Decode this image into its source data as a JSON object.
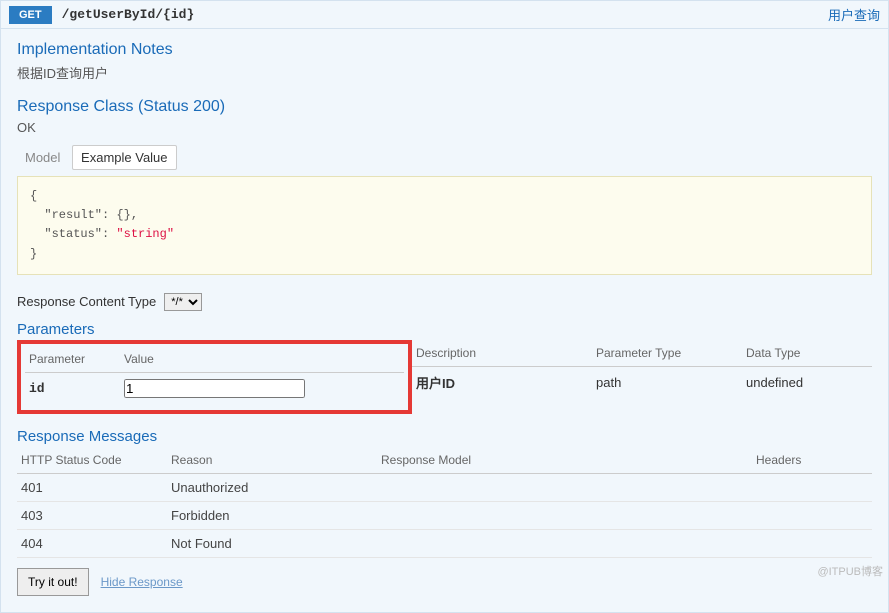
{
  "header": {
    "method": "GET",
    "path": "/getUserById/{id}",
    "summary": "用户查询"
  },
  "notes": {
    "title": "Implementation Notes",
    "text": "根据ID查询用户"
  },
  "response_class": {
    "title": "Response Class (Status 200)",
    "status": "OK",
    "tab_model": "Model",
    "tab_example": "Example Value",
    "example_lines": [
      "{",
      "  \"result\": {},",
      "  \"status\": \"string\"",
      "}"
    ]
  },
  "content_type": {
    "label": "Response Content Type",
    "value": "*/*"
  },
  "parameters": {
    "title": "Parameters",
    "headers": {
      "parameter": "Parameter",
      "value": "Value",
      "description": "Description",
      "ptype": "Parameter Type",
      "dtype": "Data Type"
    },
    "row": {
      "name": "id",
      "value": "1",
      "description": "用户ID",
      "ptype": "path",
      "dtype": "undefined"
    }
  },
  "response_messages": {
    "title": "Response Messages",
    "headers": {
      "code": "HTTP Status Code",
      "reason": "Reason",
      "model": "Response Model",
      "headers": "Headers"
    },
    "rows": [
      {
        "code": "401",
        "reason": "Unauthorized"
      },
      {
        "code": "403",
        "reason": "Forbidden"
      },
      {
        "code": "404",
        "reason": "Not Found"
      }
    ]
  },
  "actions": {
    "try": "Try it out!",
    "hide": "Hide Response"
  },
  "watermark": "@ITPUB博客"
}
